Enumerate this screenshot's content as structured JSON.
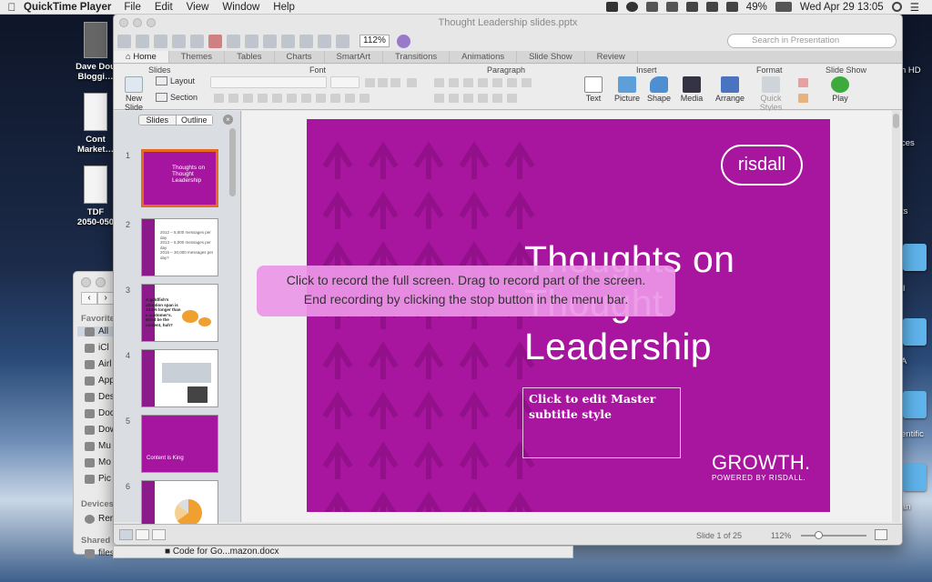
{
  "menubar": {
    "app_name": "QuickTime Player",
    "items": [
      "File",
      "Edit",
      "View",
      "Window",
      "Help"
    ],
    "battery": "49%",
    "clock": "Wed Apr 29  13:05"
  },
  "desktop": {
    "icons": [
      {
        "label": "Dave Dou\nBloggi…"
      },
      {
        "label": "Cont\nMarket…"
      },
      {
        "label": "TDF\n2050-050"
      }
    ],
    "right_labels": [
      "h HD",
      "ces",
      "ts",
      "ll",
      "A",
      "entific",
      "an"
    ]
  },
  "finder": {
    "favorites_header": "Favorites",
    "favorites": [
      "All",
      "iCl",
      "Airl",
      "App",
      "Des",
      "Doc",
      "Dow",
      "Mu",
      "Mo",
      "Pic"
    ],
    "devices_header": "Devices",
    "devices": [
      "Rer"
    ],
    "shared_header": "Shared",
    "shared": [
      "files inte"
    ]
  },
  "ppt": {
    "title": "Thought Leadership slides.pptx",
    "zoom": "112%",
    "search_placeholder": "Search in Presentation",
    "tabs": [
      "Home",
      "Themes",
      "Tables",
      "Charts",
      "SmartArt",
      "Transitions",
      "Animations",
      "Slide Show",
      "Review"
    ],
    "active_tab": "Home",
    "groups": {
      "slides": "Slides",
      "font": "Font",
      "paragraph": "Paragraph",
      "insert": "Insert",
      "format": "Format",
      "slide_show": "Slide Show"
    },
    "ribbon": {
      "new_slide": "New Slide",
      "layout": "Layout",
      "section": "Section",
      "text": "Text",
      "picture": "Picture",
      "shape": "Shape",
      "media": "Media",
      "arrange": "Arrange",
      "quick_styles": "Quick Styles",
      "play": "Play"
    },
    "pane_tabs": {
      "slides": "Slides",
      "outline": "Outline",
      "active": "Outline"
    },
    "thumbnails": [
      {
        "num": "1",
        "title": "Thoughts on\nThought\nLeadership"
      },
      {
        "num": "2",
        "title": "2012 – 5,000 messages per day\n2013 – 5,000 messages per day\n2015 – 30,000 messages per day?"
      },
      {
        "num": "3",
        "title": "A goldfish's attention span is 13.5% longer than a customer's. Blind be the content, huh?"
      },
      {
        "num": "4",
        "title": ""
      },
      {
        "num": "5",
        "title": "Content is King"
      },
      {
        "num": "6",
        "title": ""
      }
    ],
    "slide": {
      "logo": "risdall",
      "title": "Thoughts on\nThought\nLeadership",
      "subtitle": "Click to edit Master subtitle style",
      "tagline": "GROWTH.",
      "powered_by": "POWERED BY RISDALL."
    },
    "status": {
      "slide_counter": "Slide 1 of 25",
      "zoom": "112%"
    }
  },
  "overlay": {
    "line1": "Click to record the full screen. Drag to record part of the screen.",
    "line2": "End recording by clicking the stop button in the menu bar."
  },
  "dock_item": "Code for Go...mazon.docx",
  "colors": {
    "slide_bg": "#a8159f",
    "selected_thumb_border": "#e86a1d",
    "overlay": "#eb96e6"
  }
}
